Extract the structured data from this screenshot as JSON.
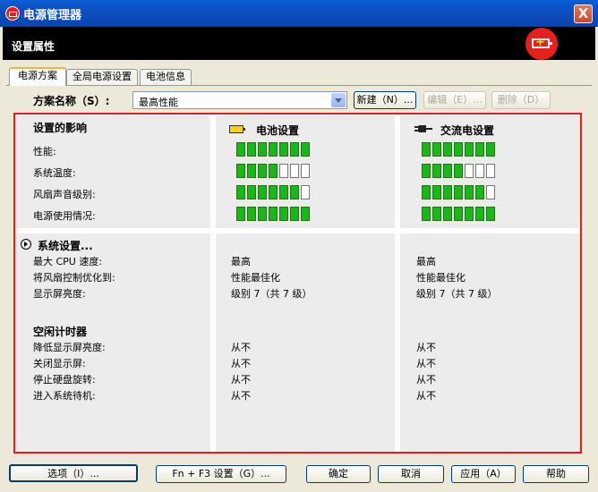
{
  "window": {
    "title": "电源管理器",
    "close_label": "X"
  },
  "header": {
    "title": "设置属性"
  },
  "tabs": [
    {
      "label": "电源方案"
    },
    {
      "label": "全局电源设置"
    },
    {
      "label": "电池信息"
    }
  ],
  "scheme": {
    "label": "方案名称（S）:",
    "selected": "最高性能",
    "new_label": "新建（N）...",
    "edit_label": "编辑（E）...",
    "delete_label": "删除（D）"
  },
  "impact": {
    "title": "设置的影响",
    "battery_header": "电池设置",
    "ac_header": "交流电设置",
    "rows": [
      {
        "label": "性能:",
        "battery": 7,
        "ac": 7
      },
      {
        "label": "系统温度:",
        "battery": 4,
        "ac": 4
      },
      {
        "label": "风扇声音级别:",
        "battery": 6,
        "ac": 6
      },
      {
        "label": "电源使用情况:",
        "battery": 7,
        "ac": 7
      }
    ],
    "max_segments": 7
  },
  "system": {
    "title": "系统设置...",
    "rows": [
      {
        "label": "最大 CPU 速度:",
        "battery": "最高",
        "ac": "最高"
      },
      {
        "label": "将风扇控制优化到:",
        "battery": "性能最佳化",
        "ac": "性能最佳化"
      },
      {
        "label": "显示屏亮度:",
        "battery": "级别 7（共 7 级）",
        "ac": "级别 7（共 7 级）"
      }
    ]
  },
  "idle": {
    "title": "空闲计时器",
    "rows": [
      {
        "label": "降低显示屏亮度:",
        "battery": "从不",
        "ac": "从不"
      },
      {
        "label": "关闭显示屏:",
        "battery": "从不",
        "ac": "从不"
      },
      {
        "label": "停止硬盘旋转:",
        "battery": "从不",
        "ac": "从不"
      },
      {
        "label": "进入系统待机:",
        "battery": "从不",
        "ac": "从不"
      }
    ]
  },
  "footer": {
    "options_label": "选项（I）...",
    "fn_label": "Fn + F3 设置（G）...",
    "ok_label": "确定",
    "cancel_label": "取消",
    "apply_label": "应用（A）",
    "help_label": "帮助"
  },
  "colors": {
    "panel_border": "#e61a1a",
    "bar_on": "#17b917",
    "badge": "#e8201c"
  }
}
